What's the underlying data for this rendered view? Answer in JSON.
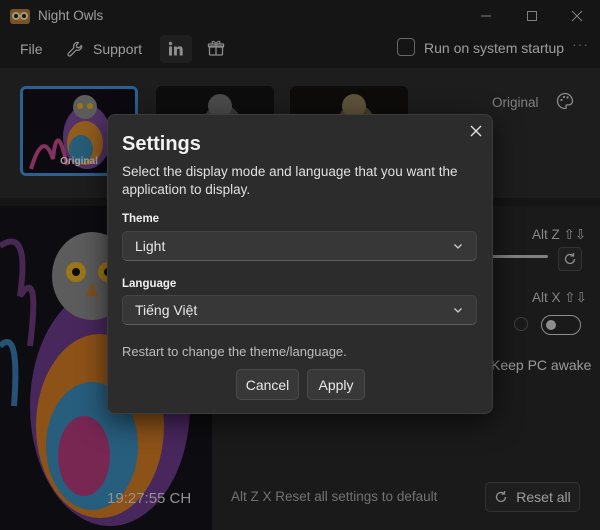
{
  "window": {
    "title": "Night Owls"
  },
  "menu": {
    "file": "File",
    "support": "Support",
    "run_on_startup": "Run on system startup"
  },
  "thumbnails": [
    {
      "label": "Original",
      "selected": true
    },
    {
      "label": "",
      "selected": false
    },
    {
      "label": "",
      "selected": false
    }
  ],
  "mode_label": "Original",
  "hotkeys": {
    "first": "Alt Z ⇧⇩",
    "second": "Alt X ⇧⇩"
  },
  "keep_awake": "Keep PC awake",
  "clock": "19:27:55 CH",
  "footer": {
    "hint": "Alt Z X  Reset all settings to default",
    "reset_all": "Reset all"
  },
  "dialog": {
    "title": "Settings",
    "description": "Select the display mode and language that you want the application to display.",
    "theme_label": "Theme",
    "theme_value": "Light",
    "language_label": "Language",
    "language_value": "Tiếng Việt",
    "restart_note": "Restart to change the theme/language.",
    "cancel": "Cancel",
    "apply": "Apply"
  },
  "colors": {
    "accent": "#3b8fd8",
    "background": "#202020",
    "dialog": "#2c2c2c"
  },
  "icons": [
    "owl-app-icon",
    "wrench-icon",
    "linkedin-icon",
    "gift-icon",
    "palette-icon",
    "refresh-icon",
    "close-icon",
    "chevron-down-icon",
    "minimize-icon",
    "maximize-icon"
  ]
}
